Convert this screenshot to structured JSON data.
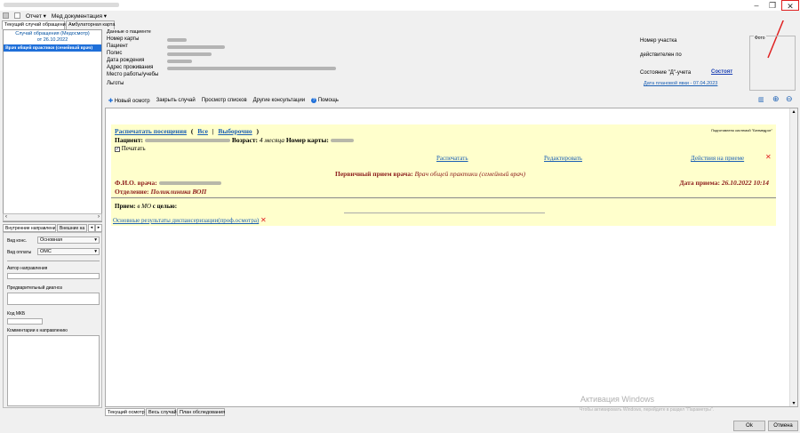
{
  "window": {
    "restore_glyph": "❐",
    "close_glyph": "✕"
  },
  "menu": {
    "report": "Отчет ▾",
    "med_docs": "Мед документация ▾"
  },
  "tabs": {
    "current_case": "Текущий случай обращения",
    "outpatient_card": "Амбулаторная карта"
  },
  "left_panel": {
    "header_line1": "Случай обращения (Медосмотр)",
    "header_line2": "от 26.10.2022",
    "selected_item": "Врач общей практики (семейный врач)"
  },
  "left_lower_tabs": {
    "internal": "Внутренние направления",
    "external": "Внешние на"
  },
  "left_form": {
    "vid_kons_label": "Вид конс.",
    "vid_kons_value": "Основная",
    "vid_oplaty_label": "Вид оплаты",
    "vid_oplaty_value": "ОМС",
    "author_label": "Автор направления",
    "diagnosis_label": "Предварительный диагноз",
    "mkb_label": "Код МКБ",
    "comments_label": "Комментарии к направлению"
  },
  "patient": {
    "section_title": "Данные о пациенте",
    "card_label": "Номер карты",
    "patient_label": "Пациент",
    "policy_label": "Полис",
    "birth_label": "Дата рождения",
    "address_label": "Адрес проживания",
    "work_label": "Место работы/учебы",
    "benefits_label": "Льготы",
    "district_label": "Номер участка",
    "active_label": "действителен по",
    "d_state_label": "Состояние \"Д\"-учета",
    "d_state_link": "Состоят",
    "planned_date": "Дата плановой явки - 07.04.2023",
    "photo_label": "Фото"
  },
  "toolbar": {
    "new_exam": "Новый осмотр",
    "close_case": "Закрыть случай",
    "view_lists": "Просмотр списков",
    "other_consults": "Другие консультации",
    "help": "Помощь"
  },
  "doc": {
    "print_visits": "Распечатать посещения",
    "open_paren": "(",
    "all": "Все",
    "sep": "|",
    "selective": "Выборочно",
    "close_paren": ")",
    "signed_note": "Подготовлено системой \"Белмедрот\"",
    "patient_label": "Пациент:",
    "age_label": "Возраст:",
    "age_value": "4 месяца",
    "card_label": "Номер карты:",
    "print_checkbox": "Печатать",
    "act_print": "Распечатать",
    "act_edit": "Редактировать",
    "act_actions": "Действия на приеме",
    "visit_title": "Первичный прием врача:",
    "visit_specialty": "Врач общей практики (семейный врач)",
    "doctor_label": "Ф.И.О. врача:",
    "visit_date_label": "Дата приема:",
    "visit_date": "26.10.2022 10:14",
    "department_label": "Отделение:",
    "department_value": "Поликлиника ВОП",
    "reception_label": "Прием:",
    "reception_value": "в МО",
    "purpose_label": "с целью:",
    "dispensary_link": "Основные результаты диспансеризации(проф.осмотра)"
  },
  "bottom_tabs": {
    "current_exam": "Текущий осмотр",
    "whole_case": "Весь случай",
    "exam_plan": "План обследования"
  },
  "buttons": {
    "ok": "Ok",
    "cancel": "Отмена"
  },
  "watermark": {
    "line1": "Активация Windows",
    "line2": "Чтобы активировать Windows, перейдите в раздел \"Параметры\"."
  },
  "colors": {
    "accent": "#1e6fd9",
    "highlight": "#ffffcc",
    "alert": "#e02020"
  }
}
